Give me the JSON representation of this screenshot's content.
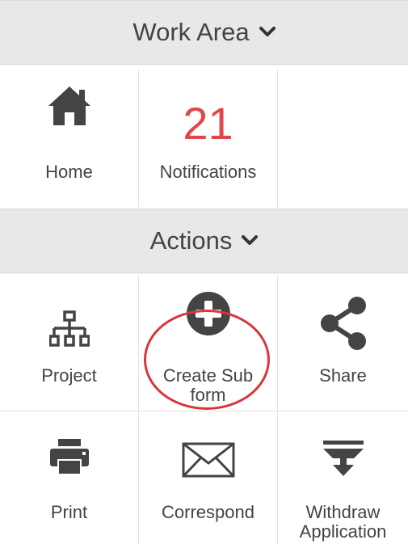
{
  "work_area": {
    "title": "Work Area",
    "items": [
      {
        "label": "Home",
        "icon": "home-icon"
      },
      {
        "label": "Notifications",
        "count": "21"
      }
    ]
  },
  "actions": {
    "title": "Actions",
    "items": [
      {
        "label": "Project",
        "icon": "sitemap-icon"
      },
      {
        "label": "Create Sub form",
        "icon": "plus-circle-icon"
      },
      {
        "label": "Share",
        "icon": "share-icon"
      },
      {
        "label": "Print",
        "icon": "printer-icon"
      },
      {
        "label": "Correspond",
        "icon": "envelope-icon"
      },
      {
        "label": "Withdraw Application",
        "icon": "withdraw-icon"
      }
    ]
  },
  "colors": {
    "notification_count": "#e0474c",
    "header_bg": "#e8e8e8",
    "highlight_ring": "#d9363e",
    "icon": "#444444"
  }
}
